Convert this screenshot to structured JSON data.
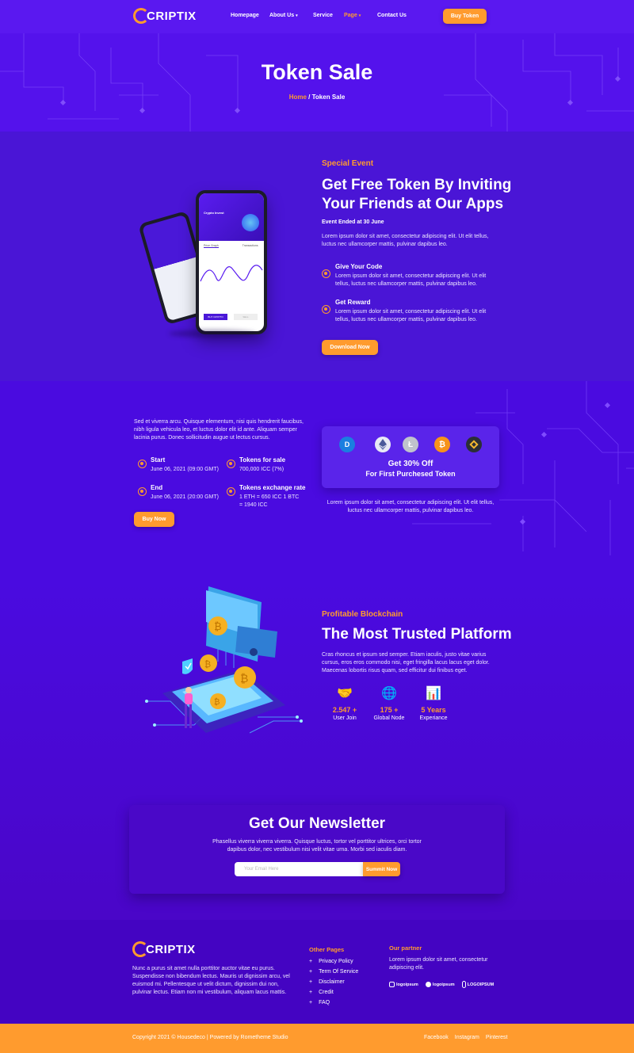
{
  "brand": {
    "logo_text": "CRIPTIX",
    "logo_letter": "C"
  },
  "nav": {
    "items": [
      {
        "label": "Homepage"
      },
      {
        "label": "About Us",
        "chevron": true
      },
      {
        "label": "Service"
      },
      {
        "label": "Page",
        "chevron": true,
        "active": true
      },
      {
        "label": "Contact Us"
      }
    ],
    "cta": "Buy Token"
  },
  "hero": {
    "title": "Token Sale",
    "breadcrumb_home": "Home",
    "breadcrumb_sep": " / ",
    "breadcrumb_current": "Token Sale"
  },
  "event": {
    "kicker": "Special Event",
    "title_line1": "Get Free Token By Inviting",
    "title_line2": "Your Friends at Our Apps",
    "subtitle": "Event Ended at 30 June",
    "body": "Lorem ipsum dolor sit amet, consectetur adipiscing elit. Ut elit tellus, luctus nec ullamcorper mattis, pulvinar dapibus leo.",
    "features": [
      {
        "title": "Give Your Code",
        "text": "Lorem ipsum dolor sit amet, consectetur adipiscing elit. Ut elit tellus, luctus nec ullamcorper mattis, pulvinar dapibus leo."
      },
      {
        "title": "Get Reward",
        "text": "Lorem ipsum dolor sit amet, consectetur adipiscing elit. Ut elit tellus, luctus nec ullamcorper mattis, pulvinar dapibus leo."
      }
    ],
    "cta": "Download Now",
    "phone": {
      "card_title": "Crypto Invest",
      "tab1": "Price Graph",
      "tab2": "Transactions",
      "btn1": "BUY CRYPTO",
      "btn2": "SELL"
    }
  },
  "sale": {
    "intro": "Sed et viverra arcu. Quisque elementum, nisi quis hendrerit faucibus, nibh ligula vehicula leo, et luctus dolor elit id ante. Aliquam semper lacinia purus. Donec sollicitudin augue ut lectus cursus.",
    "stats": [
      {
        "title": "Start",
        "value": "June 06, 2021 (09:00 GMT)"
      },
      {
        "title": "Tokens for sale",
        "value": "700,000 ICC (7%)"
      },
      {
        "title": "End",
        "value": "June 06, 2021 (20:00 GMT)"
      },
      {
        "title": "Tokens exchange rate",
        "value": "1 ETH = 650 ICC 1 BTC = 1940 ICC"
      }
    ],
    "cta": "Buy Now",
    "offer_line1": "Get 30% Off",
    "offer_line2": "For First Purchesed Token",
    "offer_note": "Lorem ipsum dolor sit amet, consectetur adipiscing elit. Ut elit tellus, luctus nec ullamcorper mattis, pulvinar dapibus leo.",
    "coins": [
      "dash-icon",
      "ethereum-icon",
      "litecoin-icon",
      "bitcoin-icon",
      "binance-icon"
    ]
  },
  "platform": {
    "kicker": "Profitable Blockchain",
    "title": "The Most Trusted Platform",
    "body": "Cras rhoncus et ipsum sed semper. Etiam iaculis, justo vitae varius cursus, eros eros commodo nisi, eget fringilla lacus lacus eget dolor. Maecenas lobortis risus quam, sed efficitur dui finibus eget.",
    "stats": [
      {
        "value": "2.547 +",
        "label": "User Join",
        "icon": "handshake-icon"
      },
      {
        "value": "175 +",
        "label": "Global Node",
        "icon": "globe-icon"
      },
      {
        "value": "5 Years",
        "label": "Experiance",
        "icon": "chart-icon"
      }
    ]
  },
  "newsletter": {
    "title": "Get Our Newsletter",
    "body": "Phasellus viverra viverra viverra. Quisque luctus, tortor vel porttitor ultrices, orci tortor dapibus dolor, nec vestibulum nisi velit vitae urna. Morbi sed iaculis diam.",
    "placeholder": "Your Email Here",
    "cta": "Summit Now"
  },
  "footer": {
    "about": "Nunc a purus sit amet nulla porttitor auctor vitae eu purus. Suspendisse non bibendum lectus. Mauris ut dignissim arcu, vel euismod mi. Pellentesque ut velit dictum, dignissim dui non, pulvinar lectus. Etiam non mi vestibulum, aliquam lacus mattis.",
    "pages_title": "Other Pages",
    "pages": [
      "Privacy Policy",
      "Term Of Service",
      "Disclaimer",
      "Credit",
      "FAQ"
    ],
    "partner_title": "Our partner",
    "partner_text": "Lorem ipsum dolor sit amet, consectetur adipiscing elit.",
    "partners": [
      "logoipsum",
      "logoipsum",
      "LOGOIPSUM"
    ],
    "copyright": "Copyright 2021 © Housedeco | Powered by Rometheme Studio",
    "social": [
      "Facebook",
      "Instagram",
      "Pinterest"
    ]
  },
  "colors": {
    "accent": "#ff9b2e",
    "primary": "#4a0bd9",
    "dark": "#4307c0"
  }
}
